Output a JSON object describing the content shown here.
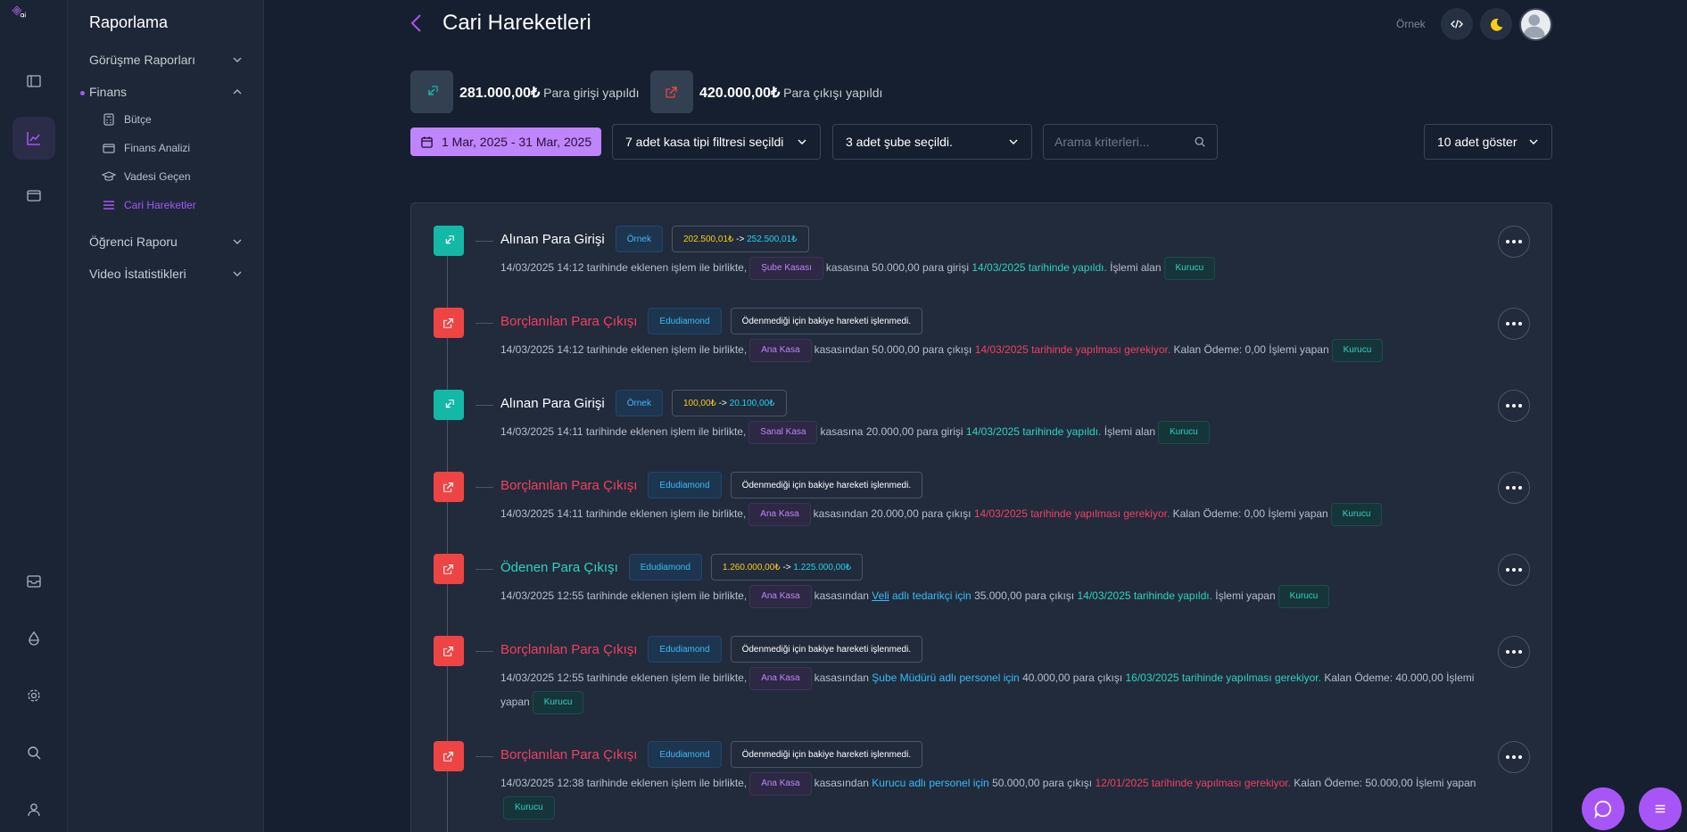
{
  "rail": {
    "items": [
      "menu-book-icon",
      "chart-icon",
      "wallet-icon",
      "inbox-icon",
      "drop-icon",
      "gear-icon",
      "search-icon",
      "user-icon"
    ]
  },
  "sidebar": {
    "title": "Raporlama",
    "groups": [
      {
        "label": "Görüşme Raporları"
      },
      {
        "label": "Finans"
      },
      {
        "label": "Öğrenci Raporu"
      },
      {
        "label": "Video İstatistikleri"
      }
    ],
    "finans_items": [
      {
        "label": "Bütçe",
        "icon": "calculator-icon"
      },
      {
        "label": "Finans Analizi",
        "icon": "wallet-icon"
      },
      {
        "label": "Vadesi Geçen",
        "icon": "graduation-cap-icon"
      },
      {
        "label": "Cari Hareketler",
        "icon": "list-icon"
      }
    ]
  },
  "header": {
    "title": "Cari Hareketleri",
    "ornek": "Örnek"
  },
  "stats": {
    "in_amount": "281.000,00₺",
    "in_text": "Para girişi yapıldı",
    "out_amount": "420.000,00₺",
    "out_text": "Para çıkışı yapıldı"
  },
  "filters": {
    "date_range": "1 Mar, 2025 - 31 Mar, 2025",
    "kasa_filter": "7 adet kasa tipi filtresi seçildi",
    "sube_filter": "3 adet şube seçildi.",
    "search_placeholder": "Arama kriterleri...",
    "page_size": "10 adet göster"
  },
  "colors": {
    "accent": "#a855f7",
    "income": "#14b8a6",
    "expense": "#ef4444"
  },
  "transactions": [
    {
      "type": "in",
      "title": "Alınan Para Girişi",
      "badge": "Örnek",
      "balance_from": "202.500,01₺",
      "balance_arrow": "->",
      "balance_to": "252.500,01₺",
      "t1": "14/03/2025 14:12 tarihinde eklenen işlem ile birlikte,",
      "kasa": "Şube Kasası",
      "t2": "kasasına 50.000,00 para girişi",
      "date_text": "14/03/2025 tarihinde yapıldı.",
      "t3": "İşlemi alan",
      "role": "Kurucu"
    },
    {
      "type": "out",
      "title": "Borçlanılan Para Çıkışı",
      "badge": "Edudiamond",
      "note": "Ödenmediği için bakiye hareketi işlenmedi.",
      "t1": "14/03/2025 14:12 tarihinde eklenen işlem ile birlikte,",
      "kasa": "Ana Kasa",
      "t2": "kasasından 50.000,00 para çıkışı",
      "date_text": "14/03/2025 tarihinde yapılması gerekiyor.",
      "t3": "Kalan Ödeme: 0,00 İşlemi yapan",
      "role": "Kurucu"
    },
    {
      "type": "in",
      "title": "Alınan Para Girişi",
      "badge": "Örnek",
      "balance_from": "100,00₺",
      "balance_arrow": "->",
      "balance_to": "20.100,00₺",
      "t1": "14/03/2025 14:11 tarihinde eklenen işlem ile birlikte,",
      "kasa": "Sanal Kasa",
      "t2": "kasasına 20.000,00 para girişi",
      "date_text": "14/03/2025 tarihinde yapıldı.",
      "t3": "İşlemi alan",
      "role": "Kurucu"
    },
    {
      "type": "out",
      "title": "Borçlanılan Para Çıkışı",
      "badge": "Edudiamond",
      "note": "Ödenmediği için bakiye hareketi işlenmedi.",
      "t1": "14/03/2025 14:11 tarihinde eklenen işlem ile birlikte,",
      "kasa": "Ana Kasa",
      "t2": "kasasından 20.000,00 para çıkışı",
      "date_text": "14/03/2025 tarihinde yapılması gerekiyor.",
      "t3": "Kalan Ödeme: 0,00 İşlemi yapan",
      "role": "Kurucu"
    },
    {
      "type": "out",
      "title": "Ödenen Para Çıkışı",
      "badge": "Edudiamond",
      "balance_from": "1.260.000,00₺",
      "balance_arrow": "->",
      "balance_to": "1.225.000,00₺",
      "t1": "14/03/2025 12:55 tarihinde eklenen işlem ile birlikte,",
      "kasa": "Ana Kasa",
      "t2a": "kasasından",
      "person_link": "Veli",
      "person_text": "adlı tedarikçi için",
      "t2": "35.000,00 para çıkışı",
      "date_text": "14/03/2025 tarihinde yapıldı.",
      "t3": "İşlemi yapan",
      "role": "Kurucu"
    },
    {
      "type": "out",
      "title": "Borçlanılan Para Çıkışı",
      "badge": "Edudiamond",
      "note": "Ödenmediği için bakiye hareketi işlenmedi.",
      "t1": "14/03/2025 12:55 tarihinde eklenen işlem ile birlikte,",
      "kasa": "Ana Kasa",
      "t2a": "kasasından",
      "person_text": "Şube Müdürü adlı personel için",
      "t2": "40.000,00 para çıkışı",
      "date_text": "16/03/2025 tarihinde yapılması gerekiyor.",
      "t3": "Kalan Ödeme: 40.000,00 İşlemi yapan",
      "role": "Kurucu"
    },
    {
      "type": "out",
      "title": "Borçlanılan Para Çıkışı",
      "badge": "Edudiamond",
      "note": "Ödenmediği için bakiye hareketi işlenmedi.",
      "t1": "14/03/2025 12:38 tarihinde eklenen işlem ile birlikte,",
      "kasa": "Ana Kasa",
      "t2a": "kasasından",
      "person_text": "Kurucu adlı personel için",
      "t2": "50.000,00 para çıkışı",
      "date_text": "12/01/2025 tarihinde yapılması gerekiyor.",
      "t3": "Kalan Ödeme: 50.000,00 İşlemi yapan",
      "role": "Kurucu"
    }
  ]
}
